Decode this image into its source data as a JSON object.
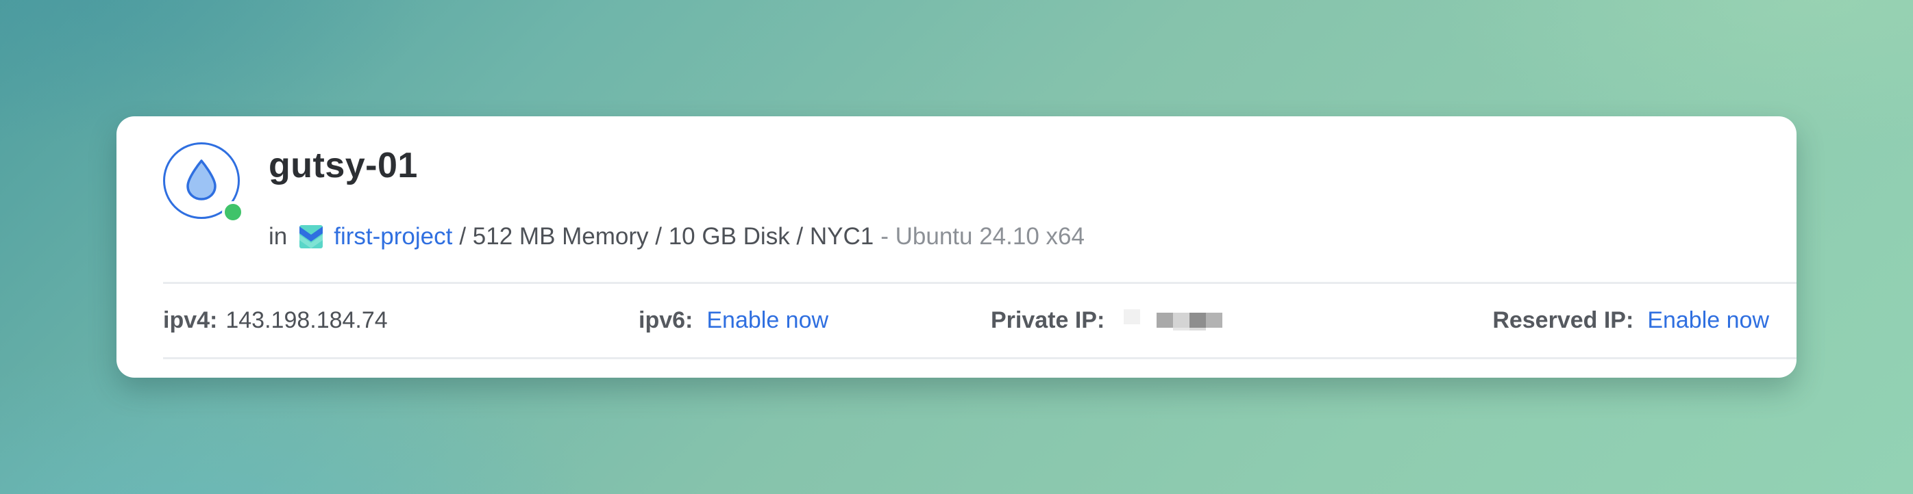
{
  "droplet": {
    "name": "gutsy-01",
    "status_color": "#40c36a",
    "in_label": "in",
    "project_name": "first-project",
    "specs": "/ 512 MB Memory / 10 GB Disk / NYC1",
    "os": "- Ubuntu 24.10 x64"
  },
  "network": {
    "ipv4_label": "ipv4:",
    "ipv4_value": "143.198.184.74",
    "ipv6_label": "ipv6:",
    "ipv6_action": "Enable now",
    "private_ip_label": "Private IP:",
    "reserved_ip_label": "Reserved IP:",
    "reserved_ip_action": "Enable now"
  },
  "colors": {
    "link": "#2f6fe0",
    "accent": "#2f6fe0",
    "status_active": "#40c36a"
  },
  "icons": {
    "droplet": "droplet-icon",
    "project": "project-icon",
    "status": "status-dot"
  }
}
